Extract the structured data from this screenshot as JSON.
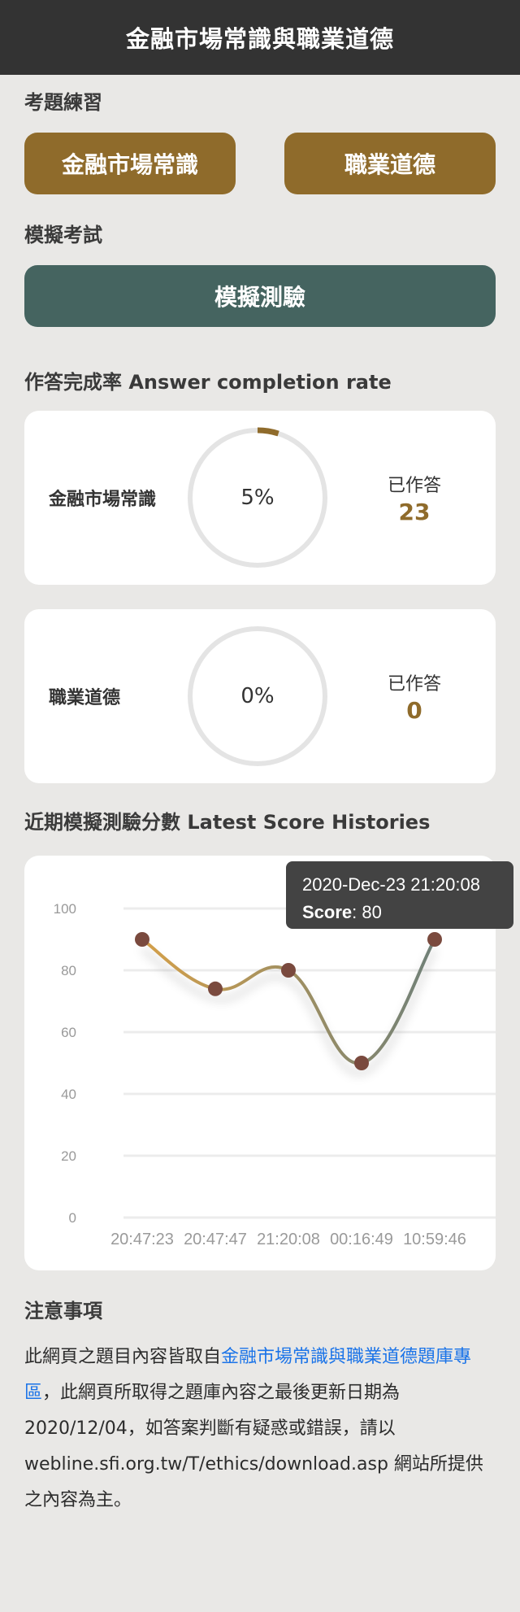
{
  "header": {
    "title": "金融市場常識與職業道德"
  },
  "practice": {
    "title": "考題練習",
    "buttons": [
      "金融市場常識",
      "職業道德"
    ]
  },
  "exam": {
    "title": "模擬考試",
    "button": "模擬測驗"
  },
  "completion": {
    "title": "作答完成率 Answer completion rate",
    "items": [
      {
        "label": "金融市場常識",
        "percent_text": "5%",
        "fraction": 0.05,
        "answered_label": "已作答",
        "answered_count": "23"
      },
      {
        "label": "職業道德",
        "percent_text": "0%",
        "fraction": 0.0,
        "answered_label": "已作答",
        "answered_count": "0"
      }
    ]
  },
  "history": {
    "title": "近期模擬測驗分數 Latest Score Histories",
    "tooltip": {
      "date": "2020-Dec-23 21:20:08",
      "score_label": "Score",
      "score_value": ": 80"
    }
  },
  "chart_data": {
    "type": "line",
    "categories": [
      "20:47:23",
      "20:47:47",
      "21:20:08",
      "00:16:49",
      "10:59:46"
    ],
    "values": [
      90,
      74,
      80,
      50,
      90
    ],
    "ylim": [
      0,
      100
    ],
    "yticks": [
      0,
      20,
      40,
      60,
      80,
      100
    ],
    "grid": true,
    "colors": {
      "line_start": "#d4a04a",
      "line_end": "#6f8078",
      "point": "#7a4a3e"
    }
  },
  "notes": {
    "title": "注意事項",
    "text_before": "此網頁之題目內容皆取自",
    "link_text": "金融市場常識與職業道德題庫專區",
    "text_after": "，此網頁所取得之題庫內容之最後更新日期為 2020/12/04，如答案判斷有疑惑或錯誤，請以 webline.sfi.org.tw/T/ethics/download.asp 網站所提供之內容為主。"
  },
  "colors": {
    "gold": "#8f6b2b",
    "teal": "#456460",
    "topbar": "#333333",
    "link": "#1a73e8"
  }
}
